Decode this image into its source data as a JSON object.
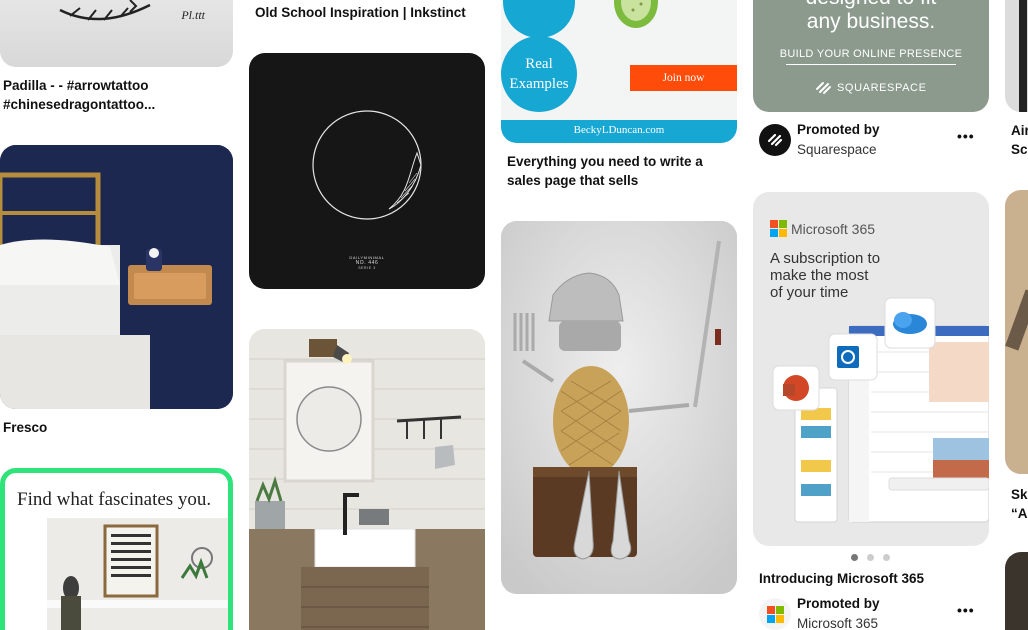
{
  "column1": {
    "pin1_caption": "Padilla - - #arrowtattoo #chinesedragontattoo...",
    "pin1_signature": "Pl.ttt",
    "pin2_caption": "Fresco",
    "pin3_headline": "Find what fascinates you."
  },
  "column2": {
    "pin1_caption": "Old School Inspiration | Inkstinct",
    "pin2_poster_line1": "DAILYMINIMAL",
    "pin2_poster_line2": "NO. 446",
    "pin2_poster_line3": "SERIE 3"
  },
  "column3": {
    "pin1_circle_label": "Real Examples",
    "pin1_button": "Join now",
    "pin1_site": "BeckyLDuncan.com",
    "pin1_caption": "Everything you need to write a sales page that sells"
  },
  "column4": {
    "ad1": {
      "headline_line1": "designed to fit",
      "headline_line2": "any business.",
      "cta": "BUILD YOUR ONLINE PRESENCE",
      "brand": "SQUARESPACE",
      "promoted_label": "Promoted by",
      "sponsor": "Squarespace",
      "more": "•••"
    },
    "ad2": {
      "brand": "Microsoft 365",
      "tagline_line1": "A subscription to",
      "tagline_line2": "make the most",
      "tagline_line3": "of your time",
      "caption": "Introducing Microsoft 365",
      "promoted_label": "Promoted by",
      "sponsor": "Microsoft 365",
      "more": "•••",
      "carousel_active": 1,
      "carousel_total": 3
    }
  },
  "column5": {
    "pin1_caption_line1": "Air",
    "pin1_caption_line2": "Scr",
    "pin2_caption_line1": "Sku",
    "pin2_caption_line2": "“Ar"
  },
  "colors": {
    "squarespace_bg": "#8b9a8d",
    "ms_red": "#f25022",
    "ms_green": "#7fba00",
    "ms_blue": "#00a4ef",
    "ms_yellow": "#ffb900",
    "cyan_accent": "#17a7d3",
    "orange_button": "#ff4c0b",
    "green_border": "#2de37a"
  }
}
